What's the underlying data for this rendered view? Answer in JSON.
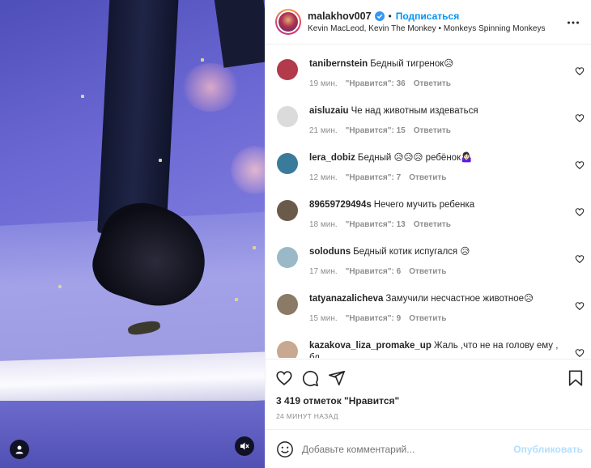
{
  "post": {
    "author": "malakhov007",
    "follow_label": "Подписаться",
    "dot": "•",
    "audio": "Kevin MacLeod, Kevin The Monkey • Monkeys Spinning Monkeys"
  },
  "comments": [
    {
      "user": "tanibernstein",
      "text": "Бедный тигренок😥",
      "time": "19 мин.",
      "likes": "\"Нравится\": 36",
      "reply": "Ответить",
      "avatar_color": "#b23a4a"
    },
    {
      "user": "aisluzaiu",
      "text": "Че над животным издеваться",
      "time": "21 мин.",
      "likes": "\"Нравится\": 15",
      "reply": "Ответить",
      "avatar_color": "#dbdbdb"
    },
    {
      "user": "lera_dobiz",
      "text": "Бедный 😥😥😥 ребёнок🤷🏻‍♀️",
      "time": "12 мин.",
      "likes": "\"Нравится\": 7",
      "reply": "Ответить",
      "avatar_color": "#3a7a9a"
    },
    {
      "user": "89659729494s",
      "text": "Нечего мучить ребенка",
      "time": "18 мин.",
      "likes": "\"Нравится\": 13",
      "reply": "Ответить",
      "avatar_color": "#6a5a4a"
    },
    {
      "user": "soloduns",
      "text": "Бедный котик испугался 😥",
      "time": "17 мин.",
      "likes": "\"Нравится\": 6",
      "reply": "Ответить",
      "avatar_color": "#9ab8c8"
    },
    {
      "user": "tatyanazalicheva",
      "text": "Замучили несчастное животное😥",
      "time": "15 мин.",
      "likes": "\"Нравится\": 9",
      "reply": "Ответить",
      "avatar_color": "#8a7a66"
    },
    {
      "user": "kazakova_liza_promake_up",
      "text": "Жаль ,что не на голову ему , бл...",
      "time": "",
      "likes": "",
      "reply": "",
      "avatar_color": "#c8a890"
    }
  ],
  "likes_count": "3 419 отметок \"Нравится\"",
  "timestamp": "24 МИНУТ НАЗАД",
  "comment_box": {
    "placeholder": "Добавьте комментарий...",
    "publish_label": "Опубликовать"
  },
  "colors": {
    "accent": "#0095f6",
    "publish_disabled": "#b2dffc",
    "muted": "#8e8e8e"
  },
  "icons": [
    "user-tag-icon",
    "mute-icon",
    "verified-icon",
    "more-icon",
    "heart-icon",
    "comment-icon",
    "share-icon",
    "bookmark-icon",
    "emoji-icon"
  ]
}
